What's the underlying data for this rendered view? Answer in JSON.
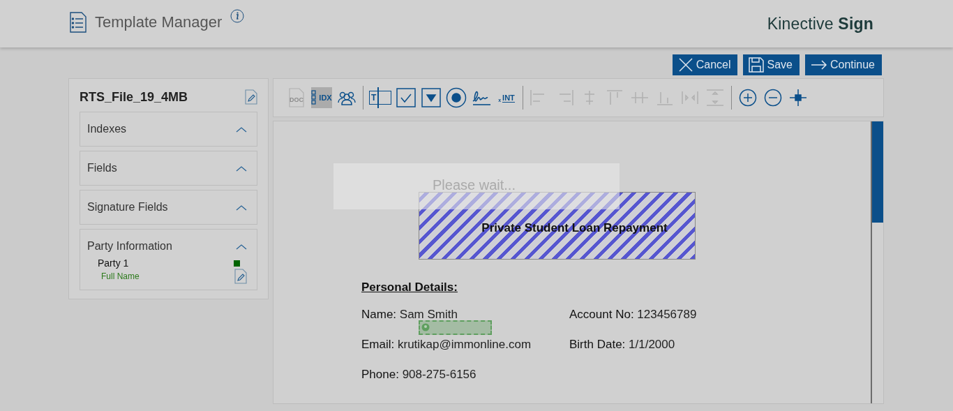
{
  "header": {
    "title": "Template Manager",
    "brand": "Kinective **Sign**"
  },
  "actions": [
    {
      "kind": "cancel",
      "label": "Cancel"
    },
    {
      "kind": "save",
      "label": "Save"
    },
    {
      "kind": "continue",
      "label": "Continue"
    }
  ],
  "sidebar": {
    "file_name": "RTS_File_19_4MB",
    "sections": [
      {
        "title": "Indexes"
      },
      {
        "title": "Fields"
      },
      {
        "title": "Signature Fields"
      },
      {
        "title": "Party Information",
        "parties": [
          {
            "name": "Party 1",
            "color": "#006400",
            "fields": [
              {
                "label": "Full Name"
              }
            ]
          }
        ]
      }
    ]
  },
  "toolbar": {
    "groups": [
      [
        {
          "kind": "doc",
          "label": "DOC",
          "selected": false,
          "disabled": true
        },
        {
          "kind": "idx",
          "label": "IDX",
          "selected": true,
          "disabled": false
        },
        {
          "kind": "parties",
          "selected": false,
          "disabled": false
        }
      ],
      [
        {
          "kind": "textbox",
          "label": "T",
          "selected": false,
          "disabled": false
        },
        {
          "kind": "checkbox",
          "selected": false,
          "disabled": false
        },
        {
          "kind": "dropdown",
          "selected": false,
          "disabled": false
        },
        {
          "kind": "radio",
          "selected": false,
          "disabled": false
        },
        {
          "kind": "signature",
          "selected": false,
          "disabled": false
        },
        {
          "kind": "initials",
          "prefix": "x",
          "label": "INT",
          "selected": false,
          "disabled": false
        }
      ],
      [
        {
          "kind": "align-left",
          "selected": false,
          "disabled": true
        },
        {
          "kind": "align-right",
          "selected": false,
          "disabled": true
        },
        {
          "kind": "align-center",
          "selected": false,
          "disabled": true
        },
        {
          "kind": "align-top",
          "selected": false,
          "disabled": true
        },
        {
          "kind": "align-middle",
          "selected": false,
          "disabled": true
        },
        {
          "kind": "align-bottom",
          "selected": false,
          "disabled": true
        },
        {
          "kind": "space-horizontal",
          "selected": false,
          "disabled": true
        },
        {
          "kind": "space-vertical",
          "selected": false,
          "disabled": true
        }
      ],
      [
        {
          "kind": "zoom-in",
          "selected": false,
          "disabled": false
        },
        {
          "kind": "zoom-out",
          "selected": false,
          "disabled": false
        },
        {
          "kind": "crosshair",
          "selected": false,
          "disabled": false
        }
      ]
    ]
  },
  "document": {
    "loading_message": "Please wait...",
    "title": "Private Student Loan Repayment",
    "section_heading": "Personal Details:",
    "rows": [
      [
        {
          "label": "Name:",
          "value": "Sam Smith"
        },
        {
          "label": "Account No:",
          "value": "123456789"
        }
      ],
      [
        {
          "label": "Email:",
          "value": "krutikap@immonline.com"
        },
        {
          "label": "Birth Date:",
          "value": "1/1/2000"
        }
      ],
      [
        {
          "label": "Phone:",
          "value": "908-275-6156"
        }
      ]
    ]
  }
}
